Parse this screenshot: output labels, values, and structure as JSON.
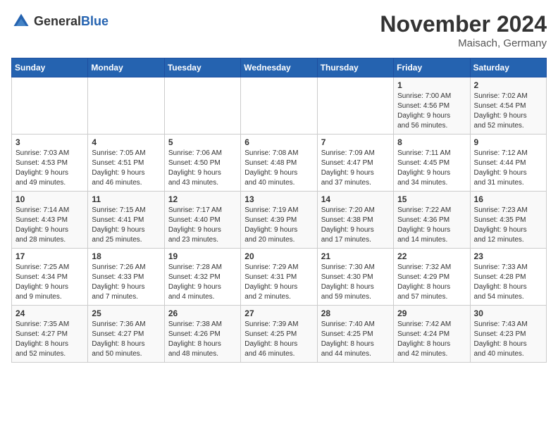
{
  "header": {
    "logo_general": "General",
    "logo_blue": "Blue",
    "title": "November 2024",
    "location": "Maisach, Germany"
  },
  "days_of_week": [
    "Sunday",
    "Monday",
    "Tuesday",
    "Wednesday",
    "Thursday",
    "Friday",
    "Saturday"
  ],
  "weeks": [
    {
      "days": [
        {
          "num": "",
          "info": ""
        },
        {
          "num": "",
          "info": ""
        },
        {
          "num": "",
          "info": ""
        },
        {
          "num": "",
          "info": ""
        },
        {
          "num": "",
          "info": ""
        },
        {
          "num": "1",
          "info": "Sunrise: 7:00 AM\nSunset: 4:56 PM\nDaylight: 9 hours\nand 56 minutes."
        },
        {
          "num": "2",
          "info": "Sunrise: 7:02 AM\nSunset: 4:54 PM\nDaylight: 9 hours\nand 52 minutes."
        }
      ]
    },
    {
      "days": [
        {
          "num": "3",
          "info": "Sunrise: 7:03 AM\nSunset: 4:53 PM\nDaylight: 9 hours\nand 49 minutes."
        },
        {
          "num": "4",
          "info": "Sunrise: 7:05 AM\nSunset: 4:51 PM\nDaylight: 9 hours\nand 46 minutes."
        },
        {
          "num": "5",
          "info": "Sunrise: 7:06 AM\nSunset: 4:50 PM\nDaylight: 9 hours\nand 43 minutes."
        },
        {
          "num": "6",
          "info": "Sunrise: 7:08 AM\nSunset: 4:48 PM\nDaylight: 9 hours\nand 40 minutes."
        },
        {
          "num": "7",
          "info": "Sunrise: 7:09 AM\nSunset: 4:47 PM\nDaylight: 9 hours\nand 37 minutes."
        },
        {
          "num": "8",
          "info": "Sunrise: 7:11 AM\nSunset: 4:45 PM\nDaylight: 9 hours\nand 34 minutes."
        },
        {
          "num": "9",
          "info": "Sunrise: 7:12 AM\nSunset: 4:44 PM\nDaylight: 9 hours\nand 31 minutes."
        }
      ]
    },
    {
      "days": [
        {
          "num": "10",
          "info": "Sunrise: 7:14 AM\nSunset: 4:43 PM\nDaylight: 9 hours\nand 28 minutes."
        },
        {
          "num": "11",
          "info": "Sunrise: 7:15 AM\nSunset: 4:41 PM\nDaylight: 9 hours\nand 25 minutes."
        },
        {
          "num": "12",
          "info": "Sunrise: 7:17 AM\nSunset: 4:40 PM\nDaylight: 9 hours\nand 23 minutes."
        },
        {
          "num": "13",
          "info": "Sunrise: 7:19 AM\nSunset: 4:39 PM\nDaylight: 9 hours\nand 20 minutes."
        },
        {
          "num": "14",
          "info": "Sunrise: 7:20 AM\nSunset: 4:38 PM\nDaylight: 9 hours\nand 17 minutes."
        },
        {
          "num": "15",
          "info": "Sunrise: 7:22 AM\nSunset: 4:36 PM\nDaylight: 9 hours\nand 14 minutes."
        },
        {
          "num": "16",
          "info": "Sunrise: 7:23 AM\nSunset: 4:35 PM\nDaylight: 9 hours\nand 12 minutes."
        }
      ]
    },
    {
      "days": [
        {
          "num": "17",
          "info": "Sunrise: 7:25 AM\nSunset: 4:34 PM\nDaylight: 9 hours\nand 9 minutes."
        },
        {
          "num": "18",
          "info": "Sunrise: 7:26 AM\nSunset: 4:33 PM\nDaylight: 9 hours\nand 7 minutes."
        },
        {
          "num": "19",
          "info": "Sunrise: 7:28 AM\nSunset: 4:32 PM\nDaylight: 9 hours\nand 4 minutes."
        },
        {
          "num": "20",
          "info": "Sunrise: 7:29 AM\nSunset: 4:31 PM\nDaylight: 9 hours\nand 2 minutes."
        },
        {
          "num": "21",
          "info": "Sunrise: 7:30 AM\nSunset: 4:30 PM\nDaylight: 8 hours\nand 59 minutes."
        },
        {
          "num": "22",
          "info": "Sunrise: 7:32 AM\nSunset: 4:29 PM\nDaylight: 8 hours\nand 57 minutes."
        },
        {
          "num": "23",
          "info": "Sunrise: 7:33 AM\nSunset: 4:28 PM\nDaylight: 8 hours\nand 54 minutes."
        }
      ]
    },
    {
      "days": [
        {
          "num": "24",
          "info": "Sunrise: 7:35 AM\nSunset: 4:27 PM\nDaylight: 8 hours\nand 52 minutes."
        },
        {
          "num": "25",
          "info": "Sunrise: 7:36 AM\nSunset: 4:27 PM\nDaylight: 8 hours\nand 50 minutes."
        },
        {
          "num": "26",
          "info": "Sunrise: 7:38 AM\nSunset: 4:26 PM\nDaylight: 8 hours\nand 48 minutes."
        },
        {
          "num": "27",
          "info": "Sunrise: 7:39 AM\nSunset: 4:25 PM\nDaylight: 8 hours\nand 46 minutes."
        },
        {
          "num": "28",
          "info": "Sunrise: 7:40 AM\nSunset: 4:25 PM\nDaylight: 8 hours\nand 44 minutes."
        },
        {
          "num": "29",
          "info": "Sunrise: 7:42 AM\nSunset: 4:24 PM\nDaylight: 8 hours\nand 42 minutes."
        },
        {
          "num": "30",
          "info": "Sunrise: 7:43 AM\nSunset: 4:23 PM\nDaylight: 8 hours\nand 40 minutes."
        }
      ]
    }
  ]
}
